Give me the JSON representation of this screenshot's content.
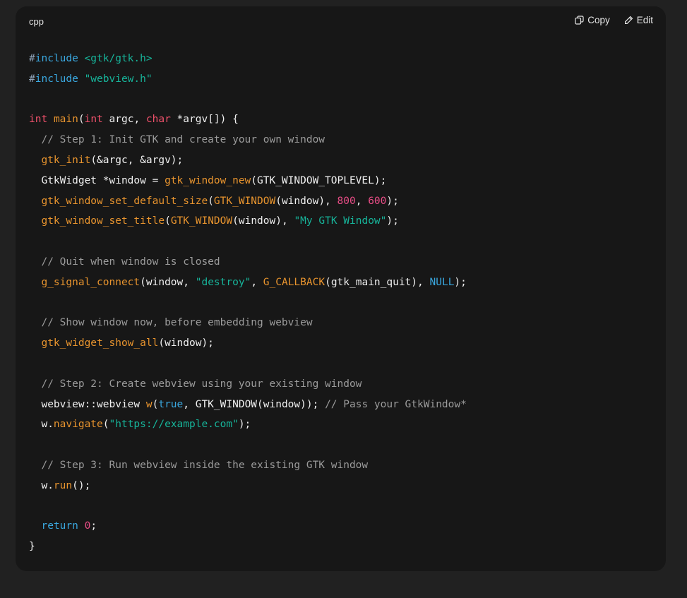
{
  "code_block": {
    "language": "cpp",
    "copy_label": "Copy",
    "edit_label": "Edit",
    "colors": {
      "background": "#171717",
      "page": "#212121",
      "keyword": "#3aa8e0",
      "type": "#f0516b",
      "function": "#e8942e",
      "string": "#17b49a",
      "number": "#e84d86",
      "comment": "#9b9b9b"
    },
    "lines": [
      [
        {
          "t": "pre",
          "v": "#"
        },
        {
          "t": "kw",
          "v": "include"
        },
        {
          "t": "plain",
          "v": " "
        },
        {
          "t": "str",
          "v": "<gtk/gtk.h>"
        }
      ],
      [
        {
          "t": "pre",
          "v": "#"
        },
        {
          "t": "kw",
          "v": "include"
        },
        {
          "t": "plain",
          "v": " "
        },
        {
          "t": "str",
          "v": "\"webview.h\""
        }
      ],
      [],
      [
        {
          "t": "type",
          "v": "int"
        },
        {
          "t": "plain",
          "v": " "
        },
        {
          "t": "fn",
          "v": "main"
        },
        {
          "t": "plain",
          "v": "("
        },
        {
          "t": "type",
          "v": "int"
        },
        {
          "t": "plain",
          "v": " argc, "
        },
        {
          "t": "type",
          "v": "char"
        },
        {
          "t": "plain",
          "v": " *argv[]) {"
        }
      ],
      [
        {
          "t": "plain",
          "v": "  "
        },
        {
          "t": "cmt",
          "v": "// Step 1: Init GTK and create your own window"
        }
      ],
      [
        {
          "t": "plain",
          "v": "  "
        },
        {
          "t": "fn",
          "v": "gtk_init"
        },
        {
          "t": "plain",
          "v": "(&argc, &argv);"
        }
      ],
      [
        {
          "t": "plain",
          "v": "  GtkWidget *window = "
        },
        {
          "t": "fn",
          "v": "gtk_window_new"
        },
        {
          "t": "plain",
          "v": "(GTK_WINDOW_TOPLEVEL);"
        }
      ],
      [
        {
          "t": "plain",
          "v": "  "
        },
        {
          "t": "fn",
          "v": "gtk_window_set_default_size"
        },
        {
          "t": "plain",
          "v": "("
        },
        {
          "t": "fn",
          "v": "GTK_WINDOW"
        },
        {
          "t": "plain",
          "v": "(window), "
        },
        {
          "t": "num",
          "v": "800"
        },
        {
          "t": "plain",
          "v": ", "
        },
        {
          "t": "num",
          "v": "600"
        },
        {
          "t": "plain",
          "v": ");"
        }
      ],
      [
        {
          "t": "plain",
          "v": "  "
        },
        {
          "t": "fn",
          "v": "gtk_window_set_title"
        },
        {
          "t": "plain",
          "v": "("
        },
        {
          "t": "fn",
          "v": "GTK_WINDOW"
        },
        {
          "t": "plain",
          "v": "(window), "
        },
        {
          "t": "str",
          "v": "\"My GTK Window\""
        },
        {
          "t": "plain",
          "v": ");"
        }
      ],
      [],
      [
        {
          "t": "plain",
          "v": "  "
        },
        {
          "t": "cmt",
          "v": "// Quit when window is closed"
        }
      ],
      [
        {
          "t": "plain",
          "v": "  "
        },
        {
          "t": "fn",
          "v": "g_signal_connect"
        },
        {
          "t": "plain",
          "v": "(window, "
        },
        {
          "t": "str",
          "v": "\"destroy\""
        },
        {
          "t": "plain",
          "v": ", "
        },
        {
          "t": "fn",
          "v": "G_CALLBACK"
        },
        {
          "t": "plain",
          "v": "(gtk_main_quit), "
        },
        {
          "t": "kw",
          "v": "NULL"
        },
        {
          "t": "plain",
          "v": ");"
        }
      ],
      [],
      [
        {
          "t": "plain",
          "v": "  "
        },
        {
          "t": "cmt",
          "v": "// Show window now, before embedding webview"
        }
      ],
      [
        {
          "t": "plain",
          "v": "  "
        },
        {
          "t": "fn",
          "v": "gtk_widget_show_all"
        },
        {
          "t": "plain",
          "v": "(window);"
        }
      ],
      [],
      [
        {
          "t": "plain",
          "v": "  "
        },
        {
          "t": "cmt",
          "v": "// Step 2: Create webview using your existing window"
        }
      ],
      [
        {
          "t": "plain",
          "v": "  webview::webview "
        },
        {
          "t": "fn",
          "v": "w"
        },
        {
          "t": "plain",
          "v": "("
        },
        {
          "t": "kw",
          "v": "true"
        },
        {
          "t": "plain",
          "v": ", GTK_WINDOW(window)); "
        },
        {
          "t": "cmt",
          "v": "// Pass your GtkWindow*"
        }
      ],
      [
        {
          "t": "plain",
          "v": "  w."
        },
        {
          "t": "fn",
          "v": "navigate"
        },
        {
          "t": "plain",
          "v": "("
        },
        {
          "t": "str",
          "v": "\"https://example.com\""
        },
        {
          "t": "plain",
          "v": ");"
        }
      ],
      [],
      [
        {
          "t": "plain",
          "v": "  "
        },
        {
          "t": "cmt",
          "v": "// Step 3: Run webview inside the existing GTK window"
        }
      ],
      [
        {
          "t": "plain",
          "v": "  w."
        },
        {
          "t": "fn",
          "v": "run"
        },
        {
          "t": "plain",
          "v": "();"
        }
      ],
      [],
      [
        {
          "t": "plain",
          "v": "  "
        },
        {
          "t": "kw",
          "v": "return"
        },
        {
          "t": "plain",
          "v": " "
        },
        {
          "t": "num",
          "v": "0"
        },
        {
          "t": "plain",
          "v": ";"
        }
      ],
      [
        {
          "t": "plain",
          "v": "}"
        }
      ]
    ]
  }
}
